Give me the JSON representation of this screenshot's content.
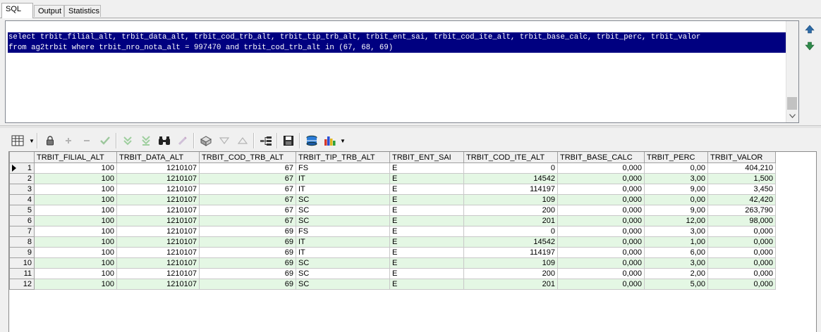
{
  "tabs": [
    {
      "label": "SQL",
      "active": true
    },
    {
      "label": "Output",
      "active": false
    },
    {
      "label": "Statistics",
      "active": false
    }
  ],
  "editor": {
    "lines": [
      "select trbit_filial_alt, trbit_data_alt, trbit_cod_trb_alt, trbit_tip_trb_alt, trbit_ent_sai, trbit_cod_ite_alt, trbit_base_calc, trbit_perc, trbit_valor",
      "from ag2trbit where trbit_nro_nota_alt = 997470 and trbit_cod_trb_alt in (67, 68, 69)"
    ]
  },
  "toolbar": {
    "icons": [
      "grid-options-icon",
      "lock-icon",
      "insert-record-icon",
      "delete-record-icon",
      "post-changes-icon",
      "fetch-next-icon",
      "fetch-last-icon",
      "find-icon",
      "clear-icon",
      "export-icon",
      "filter-down-icon",
      "filter-up-icon",
      "tree-view-icon",
      "save-icon",
      "query-by-example-icon",
      "chart-icon"
    ]
  },
  "grid": {
    "columns": [
      "TRBIT_FILIAL_ALT",
      "TRBIT_DATA_ALT",
      "TRBIT_COD_TRB_ALT",
      "TRBIT_TIP_TRB_ALT",
      "TRBIT_ENT_SAI",
      "TRBIT_COD_ITE_ALT",
      "TRBIT_BASE_CALC",
      "TRBIT_PERC",
      "TRBIT_VALOR"
    ],
    "rows": [
      [
        "1",
        "100",
        "1210107",
        "67",
        "FS",
        "E",
        "0",
        "0,000",
        "0,00",
        "404,210"
      ],
      [
        "2",
        "100",
        "1210107",
        "67",
        "IT",
        "E",
        "14542",
        "0,000",
        "3,00",
        "1,500"
      ],
      [
        "3",
        "100",
        "1210107",
        "67",
        "IT",
        "E",
        "114197",
        "0,000",
        "9,00",
        "3,450"
      ],
      [
        "4",
        "100",
        "1210107",
        "67",
        "SC",
        "E",
        "109",
        "0,000",
        "0,00",
        "42,420"
      ],
      [
        "5",
        "100",
        "1210107",
        "67",
        "SC",
        "E",
        "200",
        "0,000",
        "9,00",
        "263,790"
      ],
      [
        "6",
        "100",
        "1210107",
        "67",
        "SC",
        "E",
        "201",
        "0,000",
        "12,00",
        "98,000"
      ],
      [
        "7",
        "100",
        "1210107",
        "69",
        "FS",
        "E",
        "0",
        "0,000",
        "3,00",
        "0,000"
      ],
      [
        "8",
        "100",
        "1210107",
        "69",
        "IT",
        "E",
        "14542",
        "0,000",
        "1,00",
        "0,000"
      ],
      [
        "9",
        "100",
        "1210107",
        "69",
        "IT",
        "E",
        "114197",
        "0,000",
        "6,00",
        "0,000"
      ],
      [
        "10",
        "100",
        "1210107",
        "69",
        "SC",
        "E",
        "109",
        "0,000",
        "3,00",
        "0,000"
      ],
      [
        "11",
        "100",
        "1210107",
        "69",
        "SC",
        "E",
        "200",
        "0,000",
        "2,00",
        "0,000"
      ],
      [
        "12",
        "100",
        "1210107",
        "69",
        "SC",
        "E",
        "201",
        "0,000",
        "5,00",
        "0,000"
      ]
    ]
  },
  "colors": {
    "selection": "#000080",
    "row_alt": "#e4f7e4"
  }
}
